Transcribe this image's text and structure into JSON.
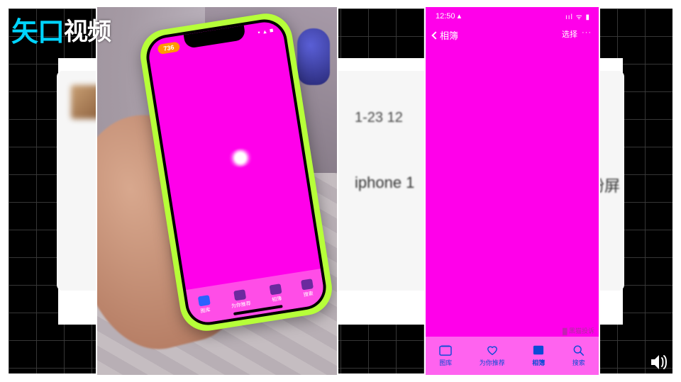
{
  "logo": {
    "accent": "矢口",
    "rest": "视频"
  },
  "background_post": {
    "line1": "1-23 12",
    "line2a": "iphone 1",
    "line2b": "册粉屏"
  },
  "left_phone": {
    "badge": "736",
    "status_right": "▪ ▴ ■",
    "tabs": [
      {
        "label": "图库"
      },
      {
        "label": "为你推荐"
      },
      {
        "label": "相簿"
      },
      {
        "label": "搜索"
      }
    ]
  },
  "right_phone": {
    "time": "12:50",
    "carrier_glyph": "▴",
    "status_right": "ııl  ᯤ  ▮",
    "nav_back": "相簿",
    "nav_select": "选择",
    "nav_more": "···",
    "tabs": [
      {
        "label": "图库"
      },
      {
        "label": "为你推荐"
      },
      {
        "label": "相簿"
      },
      {
        "label": "搜索"
      }
    ],
    "watermark": "▓ 黑猫投诉"
  }
}
